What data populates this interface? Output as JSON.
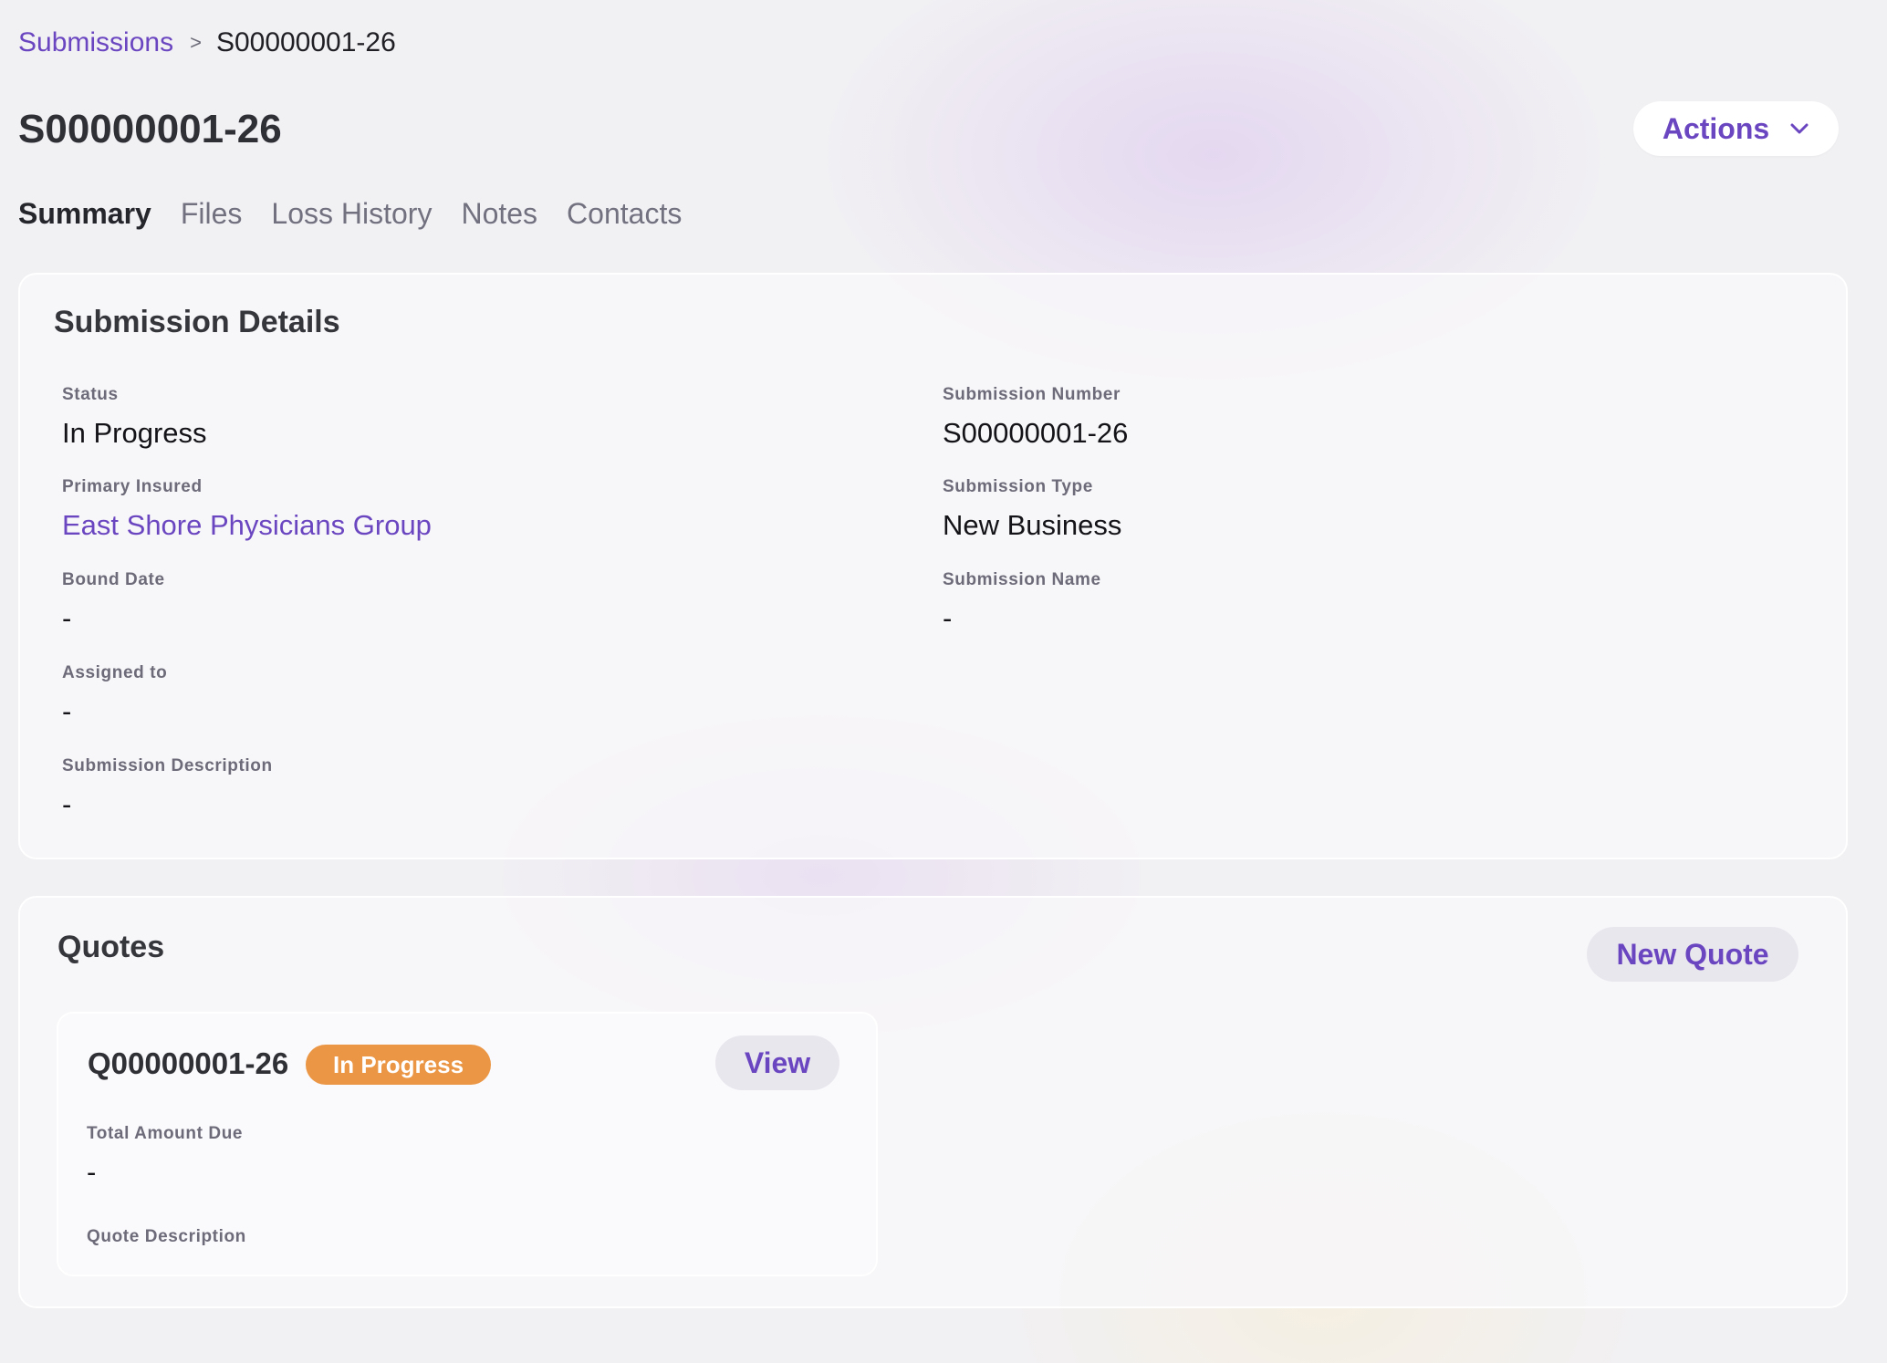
{
  "breadcrumb": {
    "parent": "Submissions",
    "separator": ">",
    "current": "S00000001-26"
  },
  "page_title": "S00000001-26",
  "actions_button": {
    "label": "Actions",
    "icon": "chevron-down-icon"
  },
  "tabs": [
    {
      "label": "Summary",
      "active": true
    },
    {
      "label": "Files",
      "active": false
    },
    {
      "label": "Loss History",
      "active": false
    },
    {
      "label": "Notes",
      "active": false
    },
    {
      "label": "Contacts",
      "active": false
    }
  ],
  "details": {
    "title": "Submission Details",
    "status": {
      "label": "Status",
      "value": "In Progress"
    },
    "primary_insured": {
      "label": "Primary Insured",
      "value": "East Shore Physicians Group"
    },
    "bound_date": {
      "label": "Bound Date",
      "value": "-"
    },
    "assigned_to": {
      "label": "Assigned to",
      "value": "-"
    },
    "description": {
      "label": "Submission Description",
      "value": "-"
    },
    "submission_number": {
      "label": "Submission Number",
      "value": "S00000001-26"
    },
    "submission_type": {
      "label": "Submission Type",
      "value": "New Business"
    },
    "submission_name": {
      "label": "Submission Name",
      "value": "-"
    }
  },
  "quotes": {
    "title": "Quotes",
    "new_quote_label": "New Quote",
    "items": [
      {
        "id": "Q00000001-26",
        "status": "In Progress",
        "status_color": "#ea9645",
        "view_label": "View",
        "total_amount_label": "Total Amount Due",
        "total_amount_value": "-",
        "description_label": "Quote Description"
      }
    ]
  },
  "colors": {
    "accent": "#6b46c1",
    "badge_in_progress": "#ea9645",
    "background": "#f1f0f3"
  }
}
